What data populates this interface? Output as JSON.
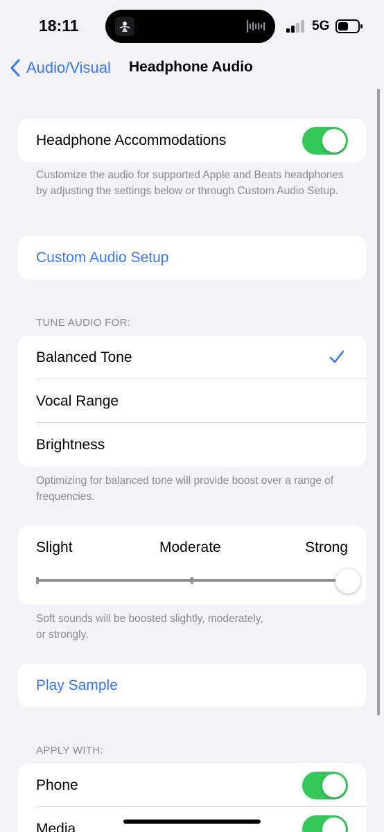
{
  "status_bar": {
    "time": "18:11",
    "network": "5G",
    "signal_icon": "cellular-signal-icon",
    "battery_icon": "battery-icon"
  },
  "nav": {
    "back_label": "Audio/Visual",
    "title": "Headphone Audio"
  },
  "accommodations": {
    "label": "Headphone Accommodations",
    "enabled": true,
    "footer": "Customize the audio for supported Apple and Beats headphones by adjusting the settings below or through Custom Audio Setup."
  },
  "custom_setup": {
    "label": "Custom Audio Setup"
  },
  "tune": {
    "header": "TUNE AUDIO FOR:",
    "options": [
      {
        "label": "Balanced Tone",
        "selected": true
      },
      {
        "label": "Vocal Range",
        "selected": false
      },
      {
        "label": "Brightness",
        "selected": false
      }
    ],
    "footer": "Optimizing for balanced tone will provide boost over a range of frequencies."
  },
  "boost": {
    "labels": [
      "Slight",
      "Moderate",
      "Strong"
    ],
    "level": 1.0,
    "footer_line1": "Soft sounds will be boosted slightly, moderately,",
    "footer_line2": "or strongly."
  },
  "play_sample": {
    "label": "Play Sample"
  },
  "apply_with": {
    "header": "APPLY WITH:",
    "items": [
      {
        "label": "Phone",
        "enabled": true
      },
      {
        "label": "Media",
        "enabled": true
      }
    ]
  },
  "colors": {
    "accent": "#3478f6",
    "toggle_on": "#34c759",
    "background": "#f2f2f7"
  }
}
